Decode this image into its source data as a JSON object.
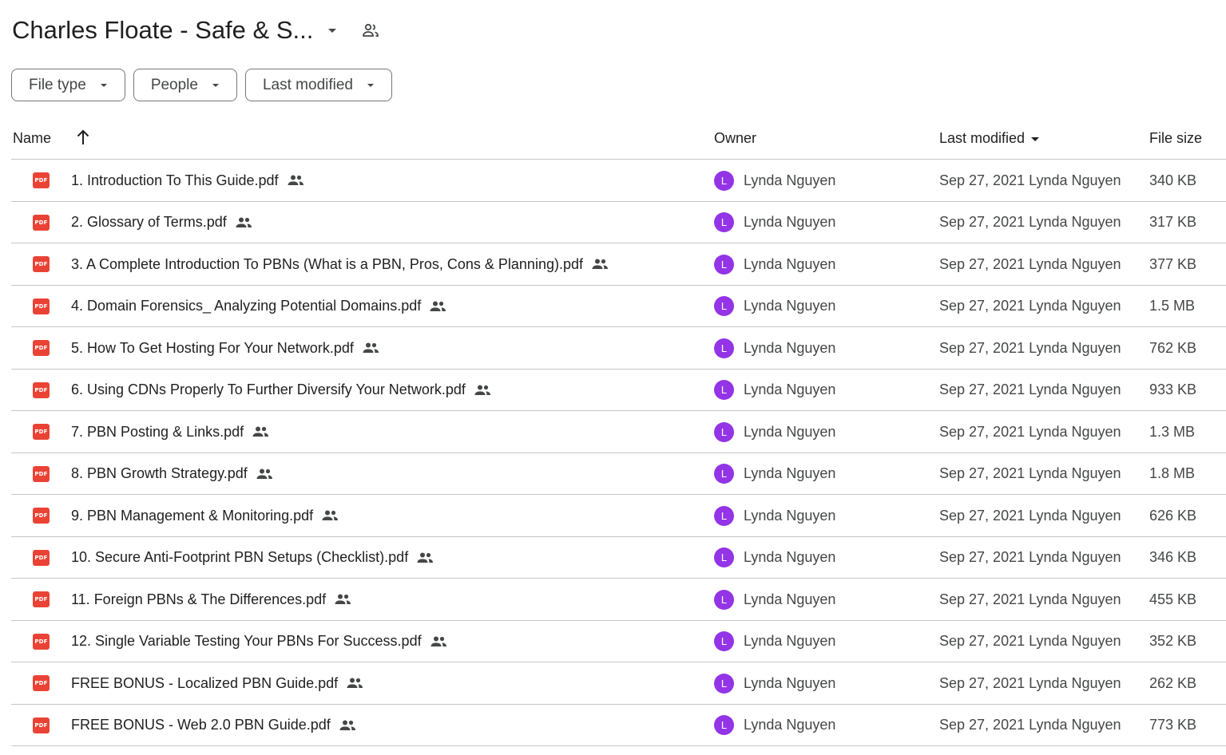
{
  "folder": {
    "title": "Charles Floate - Safe & S...",
    "caret_icon": "arrow-drop-down-icon",
    "share_icon": "people-outline-icon"
  },
  "filters": [
    {
      "label": "File type"
    },
    {
      "label": "People"
    },
    {
      "label": "Last modified"
    }
  ],
  "table": {
    "headers": {
      "name": "Name",
      "owner": "Owner",
      "modified": "Last modified",
      "size": "File size"
    },
    "sort_icon": "arrow-upward-icon",
    "rows": [
      {
        "name": "1. Introduction To This Guide.pdf",
        "owner": "Lynda Nguyen",
        "avatar": "L",
        "modified": "Sep 27, 2021 Lynda Nguyen",
        "size": "340 KB"
      },
      {
        "name": "2. Glossary of Terms.pdf",
        "owner": "Lynda Nguyen",
        "avatar": "L",
        "modified": "Sep 27, 2021 Lynda Nguyen",
        "size": "317 KB"
      },
      {
        "name": "3. A Complete Introduction To PBNs (What is a PBN, Pros, Cons & Planning).pdf",
        "owner": "Lynda Nguyen",
        "avatar": "L",
        "modified": "Sep 27, 2021 Lynda Nguyen",
        "size": "377 KB"
      },
      {
        "name": "4. Domain Forensics_ Analyzing Potential Domains.pdf",
        "owner": "Lynda Nguyen",
        "avatar": "L",
        "modified": "Sep 27, 2021 Lynda Nguyen",
        "size": "1.5 MB"
      },
      {
        "name": "5. How To Get Hosting For Your Network.pdf",
        "owner": "Lynda Nguyen",
        "avatar": "L",
        "modified": "Sep 27, 2021 Lynda Nguyen",
        "size": "762 KB"
      },
      {
        "name": "6. Using CDNs Properly To Further Diversify Your Network.pdf",
        "owner": "Lynda Nguyen",
        "avatar": "L",
        "modified": "Sep 27, 2021 Lynda Nguyen",
        "size": "933 KB"
      },
      {
        "name": "7. PBN Posting & Links.pdf",
        "owner": "Lynda Nguyen",
        "avatar": "L",
        "modified": "Sep 27, 2021 Lynda Nguyen",
        "size": "1.3 MB"
      },
      {
        "name": "8. PBN Growth Strategy.pdf",
        "owner": "Lynda Nguyen",
        "avatar": "L",
        "modified": "Sep 27, 2021 Lynda Nguyen",
        "size": "1.8 MB"
      },
      {
        "name": "9. PBN Management & Monitoring.pdf",
        "owner": "Lynda Nguyen",
        "avatar": "L",
        "modified": "Sep 27, 2021 Lynda Nguyen",
        "size": "626 KB"
      },
      {
        "name": "10. Secure Anti-Footprint PBN Setups (Checklist).pdf",
        "owner": "Lynda Nguyen",
        "avatar": "L",
        "modified": "Sep 27, 2021 Lynda Nguyen",
        "size": "346 KB"
      },
      {
        "name": "11. Foreign PBNs & The Differences.pdf",
        "owner": "Lynda Nguyen",
        "avatar": "L",
        "modified": "Sep 27, 2021 Lynda Nguyen",
        "size": "455 KB"
      },
      {
        "name": "12. Single Variable Testing Your PBNs For Success.pdf",
        "owner": "Lynda Nguyen",
        "avatar": "L",
        "modified": "Sep 27, 2021 Lynda Nguyen",
        "size": "352 KB"
      },
      {
        "name": "FREE BONUS - Localized PBN Guide.pdf",
        "owner": "Lynda Nguyen",
        "avatar": "L",
        "modified": "Sep 27, 2021 Lynda Nguyen",
        "size": "262 KB"
      },
      {
        "name": "FREE BONUS - Web 2.0 PBN Guide.pdf",
        "owner": "Lynda Nguyen",
        "avatar": "L",
        "modified": "Sep 27, 2021 Lynda Nguyen",
        "size": "773 KB"
      }
    ],
    "file_icon_label": "PDF",
    "file_icon": "pdf-icon",
    "shared_icon": "people-icon"
  },
  "colors": {
    "pdf_red": "#ea4335",
    "avatar_purple": "#9334e6",
    "divider": "#c4c7c5"
  }
}
